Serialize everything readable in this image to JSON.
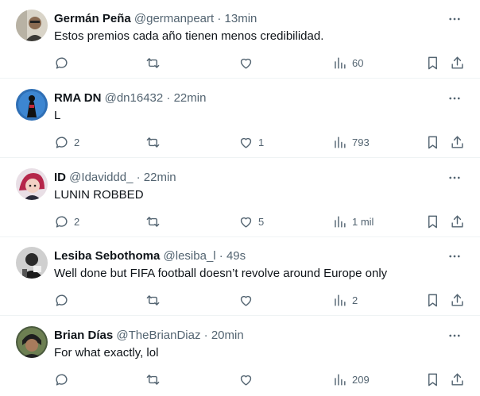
{
  "colors": {
    "text_primary": "#0f1419",
    "text_secondary": "#536471",
    "divider": "#eff3f4",
    "background": "#ffffff"
  },
  "icons": {
    "reply": "reply-icon",
    "retweet": "retweet-icon",
    "like": "heart-icon",
    "views": "views-bar-chart-icon",
    "bookmark": "bookmark-icon",
    "share": "share-icon",
    "more": "more-dots-icon"
  },
  "tweets": [
    {
      "name": "Germán Peña",
      "handle": "@germanpeart",
      "separator": "·",
      "time": "13min",
      "text": "Estos premios cada año tienen menos credibilidad.",
      "replies": "",
      "retweets": "",
      "likes": "",
      "views": "60"
    },
    {
      "name": "RMA DN",
      "handle": "@dn16432",
      "separator": "·",
      "time": "22min",
      "text": "L",
      "replies": "2",
      "retweets": "",
      "likes": "1",
      "views": "793"
    },
    {
      "name": "ID",
      "handle": "@Idaviddd_",
      "separator": "·",
      "time": "22min",
      "text": "LUNIN ROBBED",
      "replies": "2",
      "retweets": "",
      "likes": "5",
      "views": "1 mil"
    },
    {
      "name": "Lesiba Sebothoma",
      "handle": "@lesiba_l",
      "separator": "·",
      "time": "49s",
      "text": "Well done but FIFA football doesn’t revolve around Europe only",
      "replies": "",
      "retweets": "",
      "likes": "",
      "views": "2"
    },
    {
      "name": "Brian Días",
      "handle": "@TheBrianDiaz",
      "separator": "·",
      "time": "20min",
      "text": "For what exactly, lol",
      "replies": "",
      "retweets": "",
      "likes": "",
      "views": "209"
    }
  ]
}
